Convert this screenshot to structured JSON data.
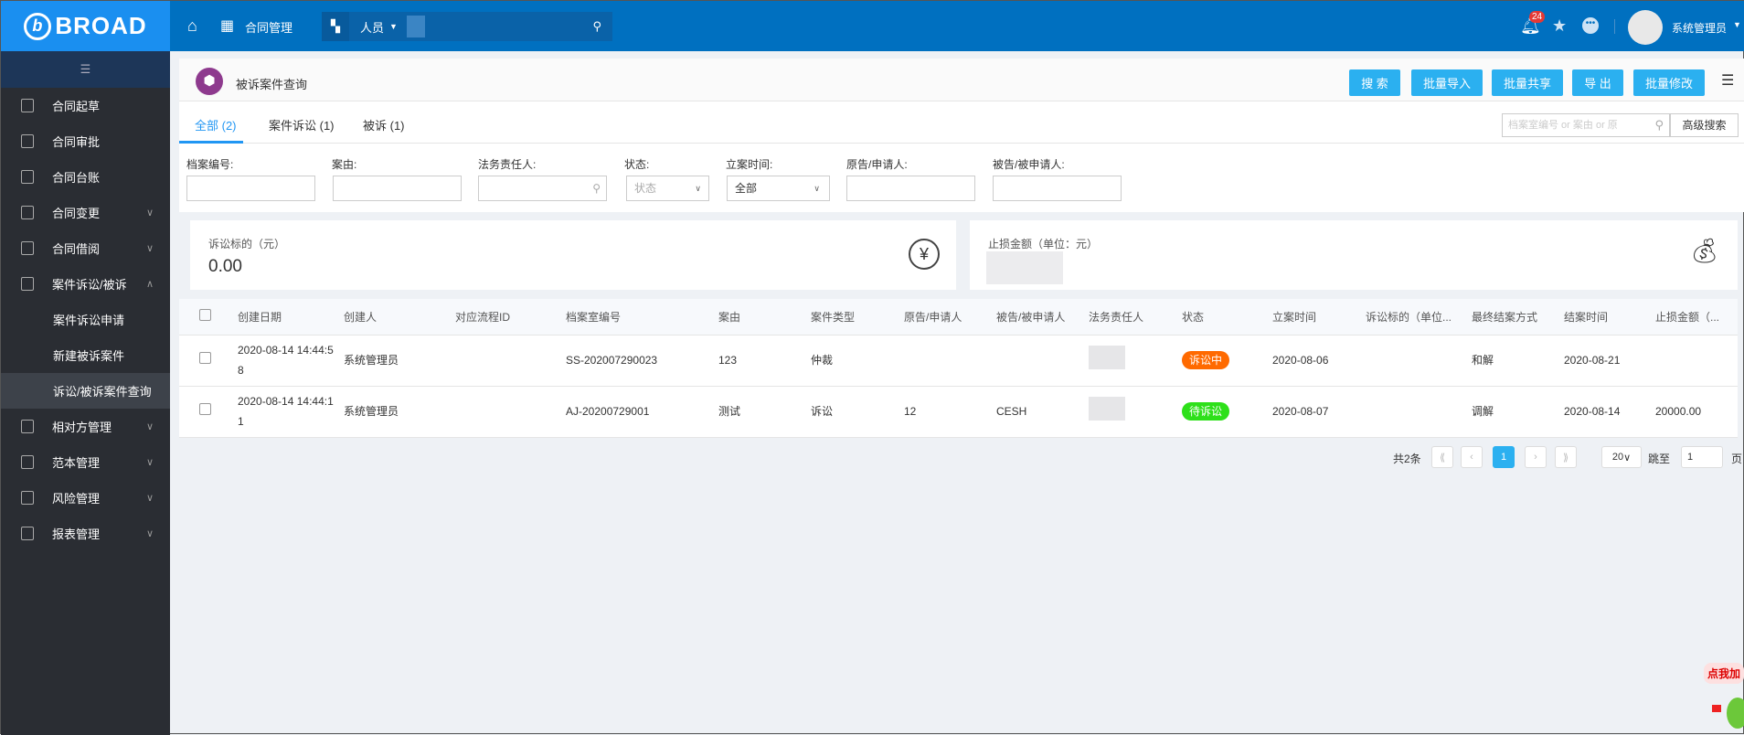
{
  "header": {
    "logo": "BROAD",
    "module": "合同管理",
    "search_scope": "人员",
    "notifications": "24",
    "user": "系统管理员"
  },
  "sidebar": {
    "items": [
      {
        "label": "合同起草"
      },
      {
        "label": "合同审批"
      },
      {
        "label": "合同台账"
      },
      {
        "label": "合同变更"
      },
      {
        "label": "合同借阅"
      },
      {
        "label": "案件诉讼/被诉"
      },
      {
        "label": "案件诉讼申请"
      },
      {
        "label": "新建被诉案件"
      },
      {
        "label": "诉讼/被诉案件查询"
      },
      {
        "label": "相对方管理"
      },
      {
        "label": "范本管理"
      },
      {
        "label": "风险管理"
      },
      {
        "label": "报表管理"
      }
    ]
  },
  "page": {
    "title": "被诉案件查询",
    "buttons": [
      "搜 索",
      "批量导入",
      "批量共享",
      "导 出",
      "批量修改"
    ],
    "tabs": [
      "全部 (2)",
      "案件诉讼 (1)",
      "被诉 (1)"
    ],
    "quick_search_placeholder": "档案室编号 or 案由 or 原",
    "advanced": "高级搜索"
  },
  "filters": {
    "labels": [
      "档案编号:",
      "案由:",
      "法务责任人:",
      "状态:",
      "立案时间:",
      "原告/申请人:",
      "被告/被申请人:"
    ],
    "status_placeholder": "状态",
    "time_value": "全部"
  },
  "cards": {
    "litigation_label": "诉讼标的（元）",
    "litigation_value": "0.00",
    "loss_label": "止损金额（单位：元）"
  },
  "table": {
    "columns": [
      "创建日期",
      "创建人",
      "对应流程ID",
      "档案室编号",
      "案由",
      "案件类型",
      "原告/申请人",
      "被告/被申请人",
      "法务责任人",
      "状态",
      "立案时间",
      "诉讼标的（单位...",
      "最终结案方式",
      "结案时间",
      "止损金额（..."
    ],
    "rows": [
      {
        "date": "2020-08-14 14:44:58",
        "creator": "系统管理员",
        "flow": "",
        "archive": "SS-202007290023",
        "cause": "123",
        "type": "仲裁",
        "plaintiff": "",
        "defendant": "",
        "status": "诉讼中",
        "status_color": "#ff6a00",
        "filed": "2020-08-06",
        "amount": "",
        "result": "和解",
        "closed": "2020-08-21",
        "loss": ""
      },
      {
        "date": "2020-08-14 14:44:11",
        "creator": "系统管理员",
        "flow": "",
        "archive": "AJ-20200729001",
        "cause": "测试",
        "type": "诉讼",
        "plaintiff": "12",
        "defendant": "CESH",
        "status": "待诉讼",
        "status_color": "#2ee01a",
        "filed": "2020-08-07",
        "amount": "",
        "result": "调解",
        "closed": "2020-08-14",
        "loss": "20000.00"
      }
    ]
  },
  "pagination": {
    "total": "共2条",
    "current": "1",
    "page_size": "20",
    "jump_label": "跳至",
    "jump_value": "1",
    "page_suffix": "页"
  },
  "widget": {
    "text": "点我加"
  }
}
